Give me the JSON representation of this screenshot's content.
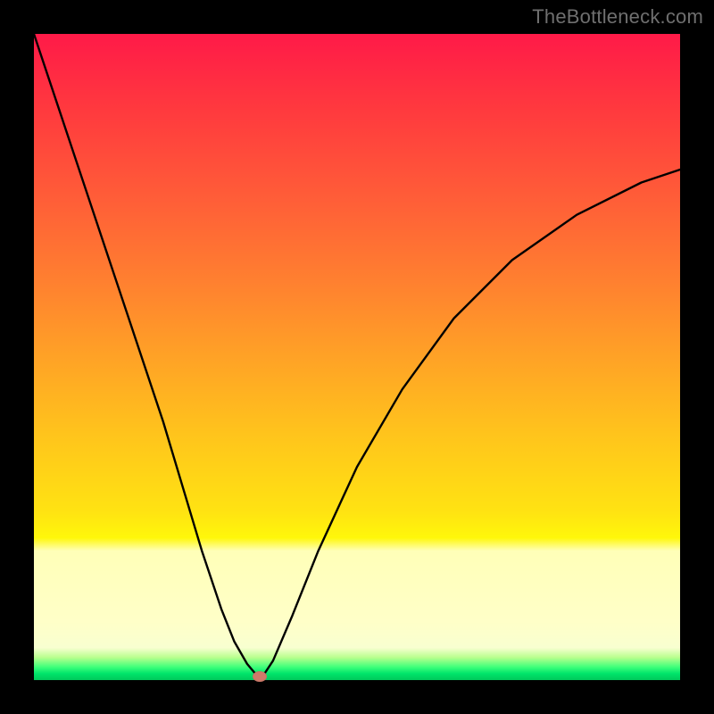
{
  "watermark": "TheBottleneck.com",
  "colors": {
    "frame": "#000000",
    "curve": "#000000",
    "dot": "#cf7a6a"
  },
  "chart_data": {
    "type": "line",
    "title": "",
    "xlabel": "",
    "ylabel": "",
    "xlim": [
      0,
      100
    ],
    "ylim": [
      0,
      100
    ],
    "grid": false,
    "legend": false,
    "annotations": [
      "TheBottleneck.com"
    ],
    "series": [
      {
        "name": "bottleneck-curve",
        "x": [
          0,
          5,
          10,
          15,
          20,
          23,
          26,
          29,
          31,
          33,
          34.5,
          35.5,
          37,
          40,
          44,
          50,
          57,
          65,
          74,
          84,
          94,
          100
        ],
        "values": [
          100,
          85,
          70,
          55,
          40,
          30,
          20,
          11,
          6,
          2.5,
          0.7,
          0.7,
          3,
          10,
          20,
          33,
          45,
          56,
          65,
          72,
          77,
          79
        ]
      }
    ],
    "marker": {
      "x": 35,
      "y": 0.5,
      "name": "bottleneck-point"
    },
    "gradient_stops": [
      {
        "pos": 0,
        "color": "#ff1a48"
      },
      {
        "pos": 0.5,
        "color": "#ffa226"
      },
      {
        "pos": 0.78,
        "color": "#fff70a"
      },
      {
        "pos": 0.9,
        "color": "#ffffc8"
      },
      {
        "pos": 0.98,
        "color": "#3dff7a"
      },
      {
        "pos": 1.0,
        "color": "#00c85a"
      }
    ]
  }
}
